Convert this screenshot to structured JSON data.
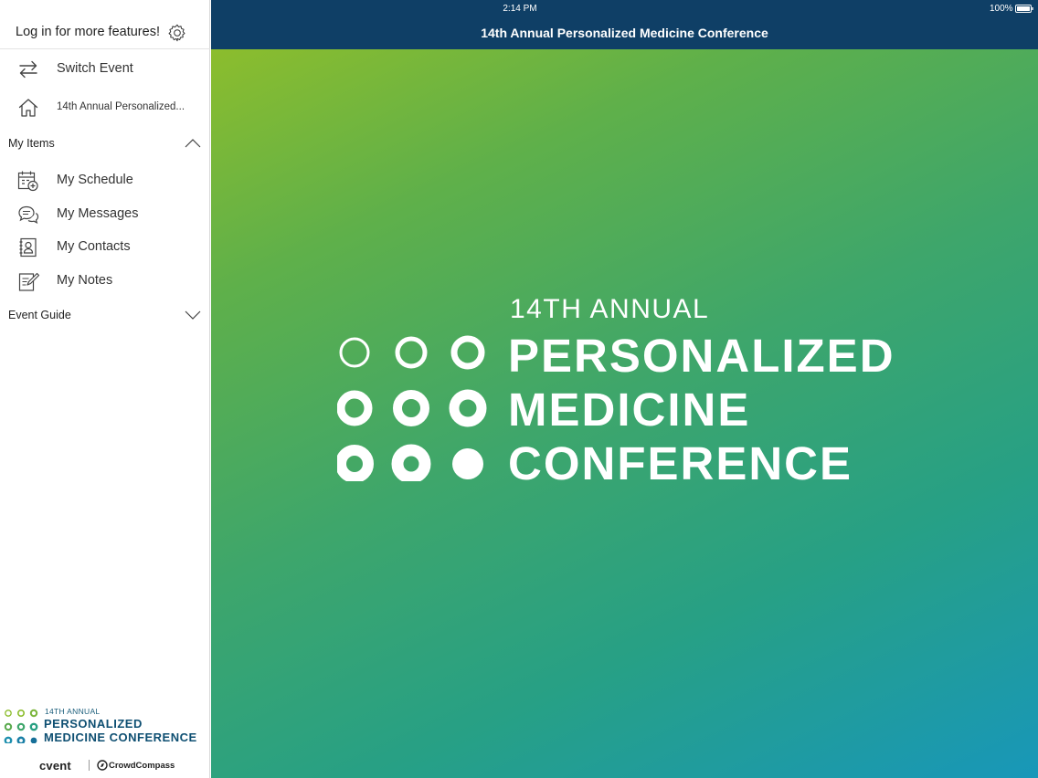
{
  "sidebar": {
    "login_text": "Log in for more features!",
    "switch_event": "Switch Event",
    "home_event": "14th Annual Personalized...",
    "sections": {
      "my_items": "My Items",
      "event_guide": "Event Guide"
    },
    "my_items": [
      {
        "label": "My Schedule",
        "icon": "calendar-add-icon"
      },
      {
        "label": "My Messages",
        "icon": "chat-bubbles-icon"
      },
      {
        "label": "My Contacts",
        "icon": "contact-card-icon"
      },
      {
        "label": "My Notes",
        "icon": "note-pencil-icon"
      }
    ],
    "footer_logo": {
      "annual": "14TH ANNUAL",
      "line1": "PERSONALIZED",
      "line2": "MEDICINE CONFERENCE"
    },
    "brand": {
      "cvent": "cvent",
      "crowdcompass": "CrowdCompass"
    }
  },
  "status_bar": {
    "time": "2:14 PM",
    "battery": "100%"
  },
  "header": {
    "title": "14th Annual Personalized Medicine Conference"
  },
  "hero": {
    "annual": "14TH ANNUAL",
    "line1": "PERSONALIZED",
    "line2": "MEDICINE",
    "line3": "CONFERENCE"
  },
  "colors": {
    "header_bg": "#0f3f66",
    "hero_gradient_start": "#8cbd2d",
    "hero_gradient_end": "#1897b9",
    "logo_text": "#0e4f72"
  }
}
